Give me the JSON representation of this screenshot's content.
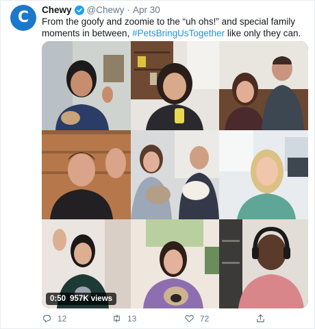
{
  "tweet": {
    "avatar_letter": "C",
    "author_name": "Chewy",
    "handle": "@Chewy",
    "separator": "·",
    "date": "Apr 30",
    "text_before": "From the goofy and zoomie to the “uh ohs!” and special family moments in between, ",
    "hashtag": "#PetsBringUsTogether",
    "text_after": " like only they can."
  },
  "video": {
    "duration": "0:50",
    "views": "957K views",
    "tiles": [
      "woman-waving-with-dog",
      "woman-with-glasses-at-bookshelf",
      "couple-with-dog",
      "man-waving-wood-wall",
      "people-with-cats",
      "woman-blonde-smiling",
      "woman-waving-kitchen",
      "woman-with-pug",
      "man-with-headphones"
    ]
  },
  "actions": {
    "reply_count": "12",
    "retweet_count": "13",
    "like_count": "72"
  },
  "colors": {
    "brand": "#1c78c9",
    "link": "#1b95e0",
    "muted": "#657786",
    "verified": "#1da1f2"
  }
}
